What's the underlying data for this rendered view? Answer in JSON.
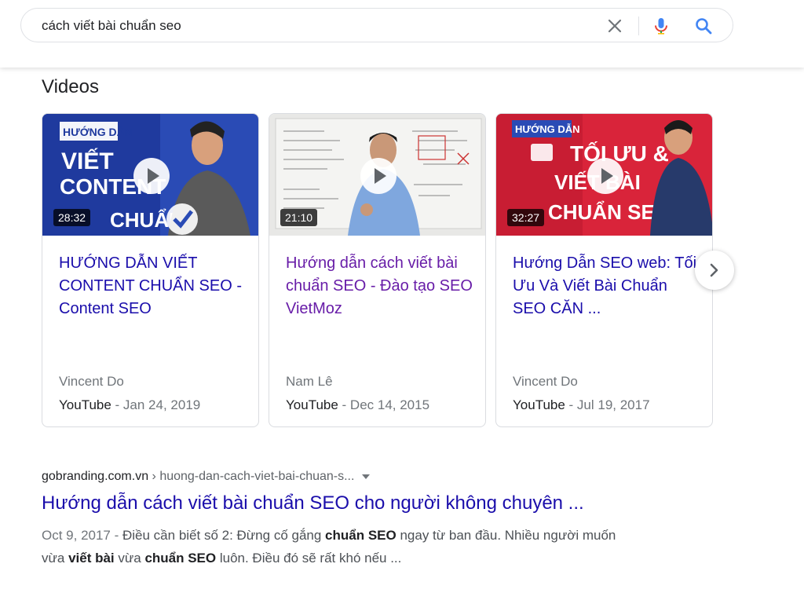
{
  "search": {
    "query": "cách viết bài chuẩn seo"
  },
  "videos": {
    "title": "Videos",
    "items": [
      {
        "thumb_text": [
          "HƯỚNG DẪN",
          "VIẾT",
          "CONTENT",
          "CHUẨN SEO"
        ],
        "duration": "28:32",
        "title": "HƯỚNG DẪN VIẾT CONTENT CHUẨN SEO - Content SEO",
        "channel": "Vincent Do",
        "source": "YouTube",
        "date": " - Jan 24, 2019"
      },
      {
        "duration": "21:10",
        "title": "Hướng dẫn cách viết bài chuẩn SEO - Đào tạo SEO VietMoz",
        "channel": "Nam Lê",
        "source": "YouTube",
        "date": " - Dec 14, 2015"
      },
      {
        "thumb_text": [
          "HƯỚNG DẪN",
          "TỐI ƯU &",
          "VIẾT BÀI",
          "CHUẨN SEO"
        ],
        "duration": "32:27",
        "title": "Hướng Dẫn SEO web: Tối Ưu Và Viết Bài Chuẩn SEO CĂN ...",
        "channel": "Vincent Do",
        "source": "YouTube",
        "date": " - Jul 19, 2017"
      }
    ]
  },
  "result": {
    "domain": "gobranding.com.vn",
    "path": " › huong-dan-cach-viet-bai-chuan-s...",
    "title": "Hướng dẫn cách viết bài chuẩn SEO cho người không chuyên ...",
    "snippet": {
      "date": "Oct 9, 2017 - ",
      "t1": "Điều cần biết số 2: Đừng cố gắng ",
      "b1": "chuẩn SEO",
      "t2": " ngay từ ban đầu. Nhiều người muốn vừa ",
      "b2": "viết bài",
      "t3": " vừa ",
      "b3": "chuẩn SEO",
      "t4": " luôn. Điều đó sẽ rất khó nếu ..."
    }
  },
  "colors": {
    "link": "#1a0dab",
    "visited": "#681da8",
    "thumb_blue": "#2a4bb5",
    "thumb_red": "#d9243a"
  },
  "icons": [
    "close-icon",
    "mic-icon",
    "search-icon",
    "play-icon",
    "chevron-right-icon",
    "caret-down-icon"
  ]
}
